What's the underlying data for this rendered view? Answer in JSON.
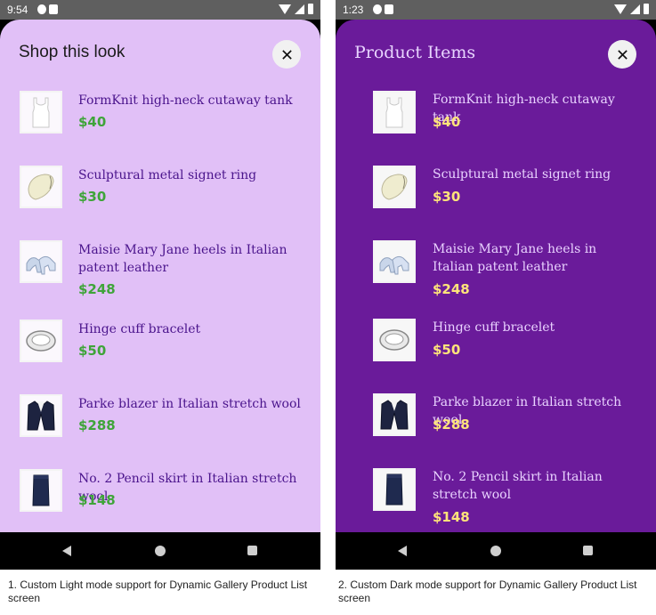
{
  "light": {
    "time": "9:54",
    "title": "Shop this look",
    "caption": "1. Custom Light mode support for Dynamic Gallery Product List screen"
  },
  "dark": {
    "time": "1:23",
    "title": "Product Items",
    "caption": "2. Custom Dark mode support for Dynamic Gallery Product List screen"
  },
  "products": [
    {
      "name": "FormKnit high-neck cutaway tank",
      "price": "$40",
      "icon": "tank-top-icon"
    },
    {
      "name": "Sculptural metal signet ring",
      "price": "$30",
      "icon": "ring-icon"
    },
    {
      "name": "Maisie Mary Jane heels in Italian patent leather",
      "price": "$248",
      "icon": "heels-icon"
    },
    {
      "name": "Hinge cuff bracelet",
      "price": "$50",
      "icon": "bracelet-icon"
    },
    {
      "name": "Parke blazer in Italian stretch wool",
      "price": "$288",
      "icon": "blazer-icon"
    },
    {
      "name": "No. 2 Pencil skirt in Italian stretch wool",
      "price": "$148",
      "icon": "skirt-icon"
    }
  ],
  "colors": {
    "light_sheet": "#e1c0f7",
    "dark_sheet": "#6a1b9a",
    "light_price": "#3fa43a",
    "dark_price": "#ffe47a"
  }
}
